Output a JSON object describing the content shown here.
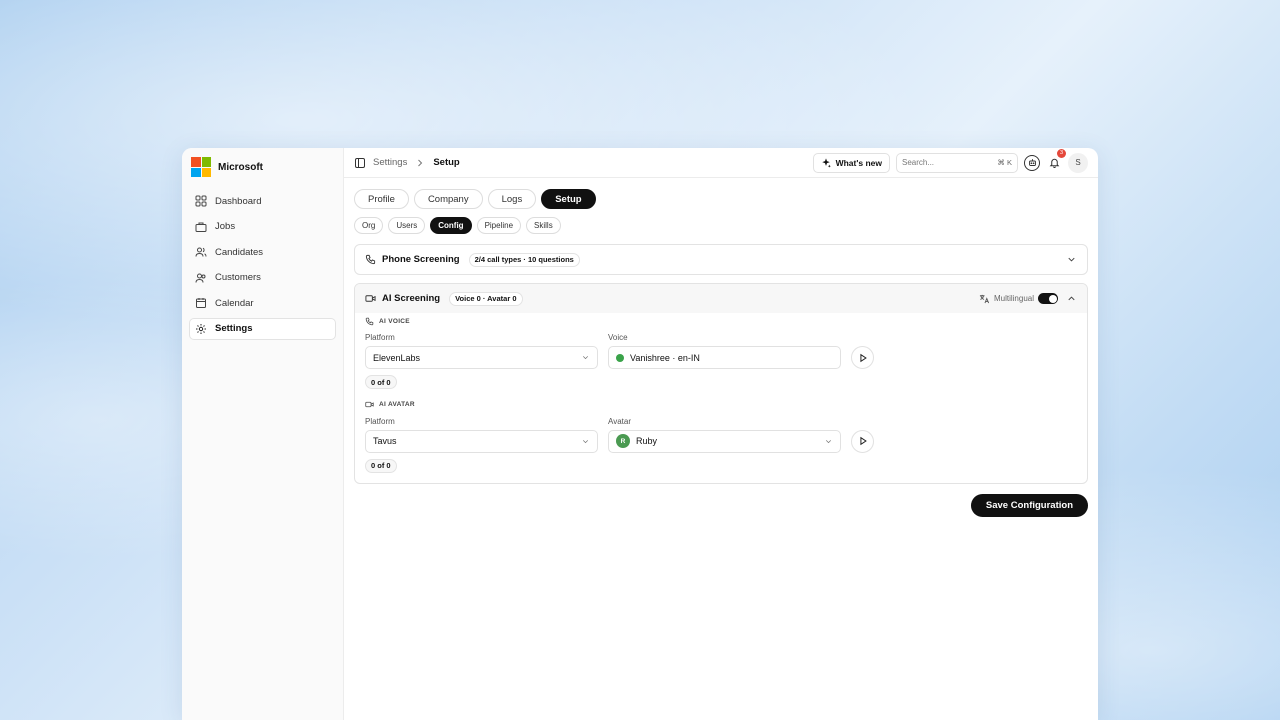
{
  "brand": {
    "name": "Microsoft",
    "logo_colors": [
      "#f25022",
      "#7fba00",
      "#00a4ef",
      "#ffb900"
    ]
  },
  "sidebar": {
    "items": [
      {
        "label": "Dashboard",
        "icon": "grid-icon"
      },
      {
        "label": "Jobs",
        "icon": "briefcase-icon"
      },
      {
        "label": "Candidates",
        "icon": "users-icon"
      },
      {
        "label": "Customers",
        "icon": "user-group-icon"
      },
      {
        "label": "Calendar",
        "icon": "calendar-icon"
      },
      {
        "label": "Settings",
        "icon": "gear-icon",
        "active": true
      }
    ]
  },
  "topbar": {
    "breadcrumb": [
      "Settings",
      "Setup"
    ],
    "whats_new": "What's new",
    "search_placeholder": "Search...",
    "search_shortcut": "⌘ K",
    "notification_count": "3",
    "avatar_initial": "S"
  },
  "tabs": [
    "Profile",
    "Company",
    "Logs",
    "Setup"
  ],
  "active_tab": "Setup",
  "subtabs": [
    "Org",
    "Users",
    "Config",
    "Pipeline",
    "Skills"
  ],
  "active_subtab": "Config",
  "phone_screening": {
    "title": "Phone Screening",
    "badge": "2/4 call types · 10 questions"
  },
  "ai_screening": {
    "title": "AI Screening",
    "badge": "Voice 0 · Avatar 0",
    "multilingual_label": "Multilingual",
    "multilingual_on": true,
    "voice_section": {
      "label": "AI VOICE",
      "platform_label": "Platform",
      "platform_value": "ElevenLabs",
      "voice_label": "Voice",
      "voice_value": "Vanishree · en-IN",
      "count": "0 of 0"
    },
    "avatar_section": {
      "label": "AI AVATAR",
      "platform_label": "Platform",
      "platform_value": "Tavus",
      "avatar_label": "Avatar",
      "avatar_initial": "R",
      "avatar_value": "Ruby",
      "count": "0 of 0"
    }
  },
  "save_button": "Save Configuration"
}
